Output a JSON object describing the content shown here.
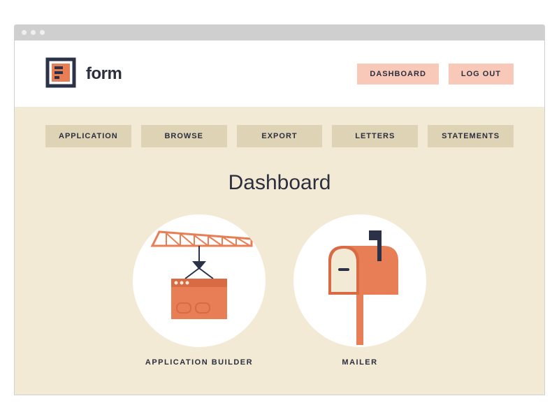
{
  "brand": {
    "name": "form"
  },
  "header": {
    "buttons": [
      {
        "label": "DASHBOARD"
      },
      {
        "label": "LOG OUT"
      }
    ]
  },
  "nav": {
    "items": [
      {
        "label": "APPLICATION"
      },
      {
        "label": "BROWSE"
      },
      {
        "label": "EXPORT"
      },
      {
        "label": "LETTERS"
      },
      {
        "label": "STATEMENTS"
      }
    ]
  },
  "page": {
    "title": "Dashboard"
  },
  "cards": [
    {
      "label": "APPLICATION BUILDER",
      "icon": "crane-icon"
    },
    {
      "label": "MAILER",
      "icon": "mailbox-icon"
    }
  ]
}
